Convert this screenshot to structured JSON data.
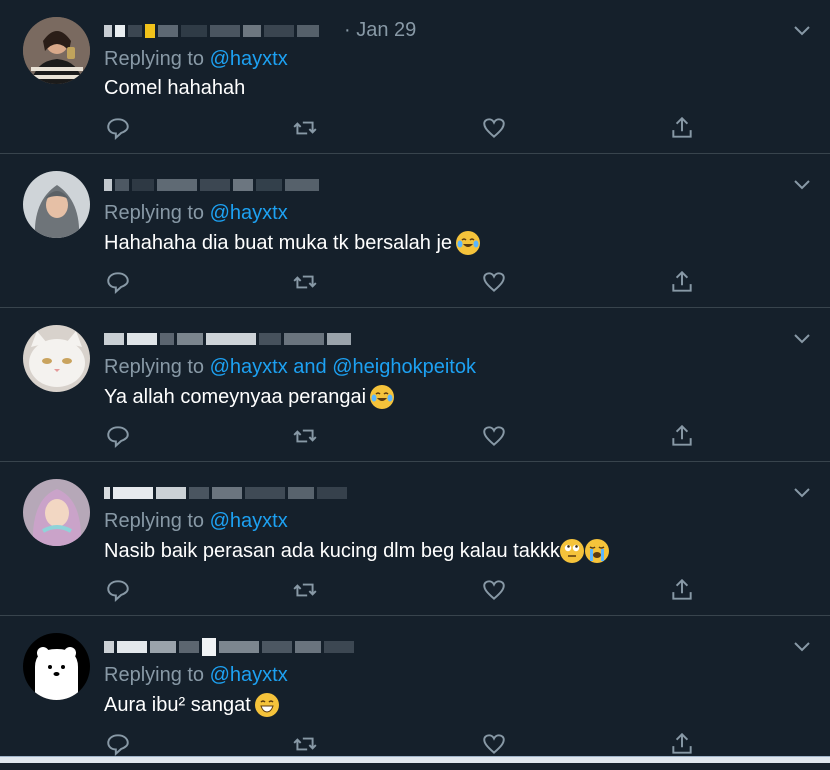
{
  "colors": {
    "background": "#15202b",
    "divider": "#38444d",
    "muted": "#8899a6",
    "link": "#1da1f2",
    "text": "#ffffff"
  },
  "replying_prefix": "Replying to",
  "tweets": [
    {
      "date": "· Jan 29",
      "reply_handles": [
        "@hayxtx"
      ],
      "text": "Comel hahahah",
      "emojis": [],
      "avatar": "girl-striped-shirt-avatar"
    },
    {
      "date": "",
      "reply_handles": [
        "@hayxtx"
      ],
      "text": "Hahahaha dia buat muka tk bersalah je",
      "emojis": [
        "tears-of-joy-emoji"
      ],
      "avatar": "hijab-girl-avatar"
    },
    {
      "date": "",
      "reply_handles": [
        "@hayxtx",
        "@heighokpeitok"
      ],
      "joiner": "and",
      "text": "Ya allah comeynyaa perangai",
      "emojis": [
        "tears-of-joy-emoji"
      ],
      "avatar": "white-cat-avatar"
    },
    {
      "date": "",
      "reply_handles": [
        "@hayxtx"
      ],
      "text": "Nasib baik perasan ada kucing dlm beg kalau takkk",
      "emojis": [
        "rolling-eyes-emoji",
        "loudly-crying-emoji"
      ],
      "avatar": "girl-selfie-avatar"
    },
    {
      "date": "",
      "reply_handles": [
        "@hayxtx"
      ],
      "text": "Aura ibu² sangat",
      "emojis": [
        "grinning-emoji"
      ],
      "avatar": "white-bear-avatar"
    }
  ],
  "action_icons": [
    "reply-icon",
    "retweet-icon",
    "like-icon",
    "share-icon"
  ]
}
